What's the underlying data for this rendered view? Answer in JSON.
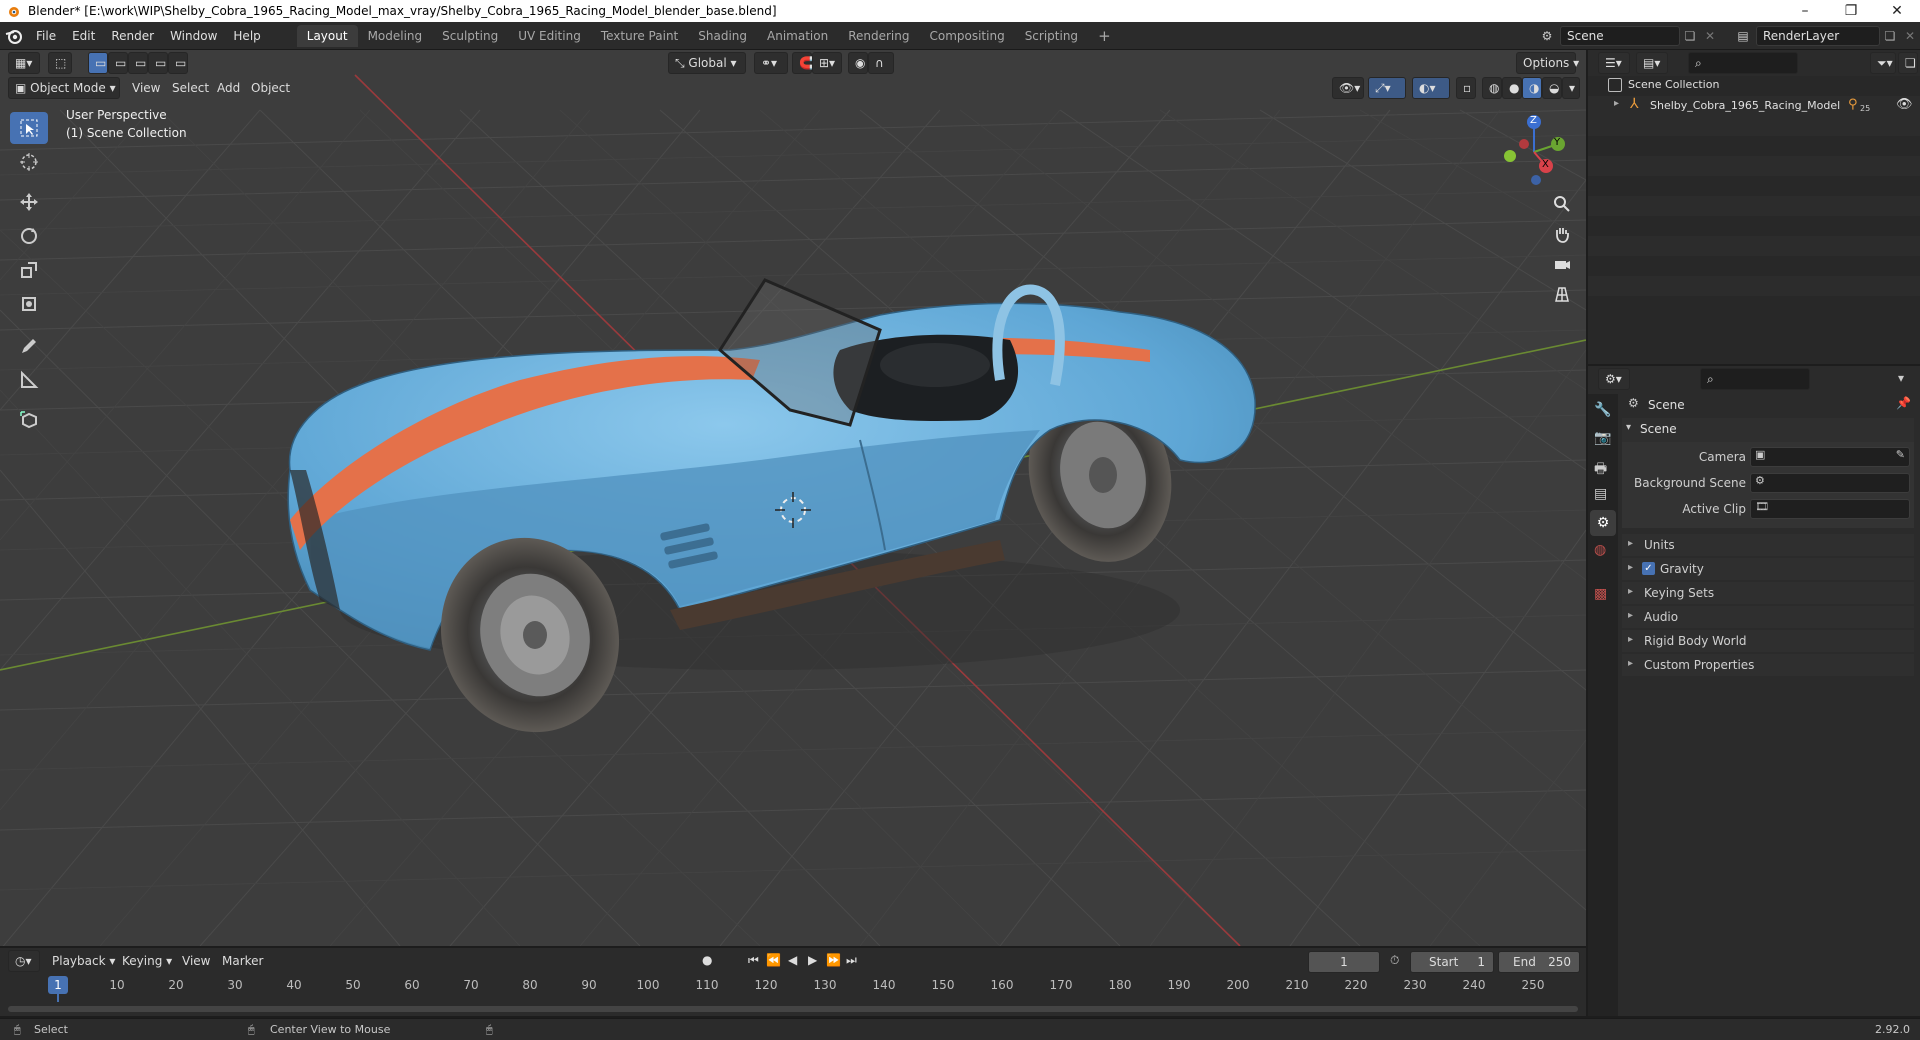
{
  "window": {
    "title": "Blender* [E:\\work\\WIP\\Shelby_Cobra_1965_Racing_Model_max_vray/Shelby_Cobra_1965_Racing_Model_blender_base.blend]",
    "minimize": "–",
    "maximize": "❐",
    "close": "✕"
  },
  "menu": [
    "File",
    "Edit",
    "Render",
    "Window",
    "Help"
  ],
  "workspaces": [
    "Layout",
    "Modeling",
    "Sculpting",
    "UV Editing",
    "Texture Paint",
    "Shading",
    "Animation",
    "Rendering",
    "Compositing",
    "Scripting"
  ],
  "workspace_add": "+",
  "scene_name": "Scene",
  "view_layer": "RenderLayer",
  "viewport": {
    "transform_orientation": "Global",
    "options_label": "Options",
    "mode": "Object Mode",
    "menus": [
      "View",
      "Select",
      "Add",
      "Object"
    ],
    "overlay_title": "User Perspective",
    "overlay_subtitle": "(1) Scene Collection",
    "gizmo": {
      "x": "X",
      "y": "Y",
      "z": "Z"
    }
  },
  "outliner": {
    "root": "Scene Collection",
    "items": [
      {
        "name": "Shelby_Cobra_1965_Racing_Model",
        "badge": "25"
      }
    ]
  },
  "properties": {
    "context": "Scene",
    "panel": "Scene",
    "fields": [
      {
        "label": "Camera"
      },
      {
        "label": "Background Scene"
      },
      {
        "label": "Active Clip"
      }
    ],
    "sections": [
      "Units",
      "Gravity",
      "Keying Sets",
      "Audio",
      "Rigid Body World",
      "Custom Properties"
    ],
    "gravity_checked": true
  },
  "timeline": {
    "menus": [
      "Playback",
      "Keying",
      "View",
      "Marker"
    ],
    "current_frame": "1",
    "start_label": "Start",
    "start": "1",
    "end_label": "End",
    "end": "250",
    "ticks": [
      "10",
      "20",
      "30",
      "40",
      "50",
      "60",
      "70",
      "80",
      "90",
      "100",
      "110",
      "120",
      "130",
      "140",
      "150",
      "160",
      "170",
      "180",
      "190",
      "200",
      "210",
      "220",
      "230",
      "240",
      "250"
    ],
    "playhead": "1"
  },
  "status": {
    "left": "Select",
    "middle": "Center View to Mouse",
    "version": "2.92.0"
  },
  "colors": {
    "accent": "#4772b3",
    "car_body": "#5fa8d8",
    "stripe": "#e4714a",
    "axis_x": "#c8373a",
    "axis_y": "#6c9a2e"
  }
}
